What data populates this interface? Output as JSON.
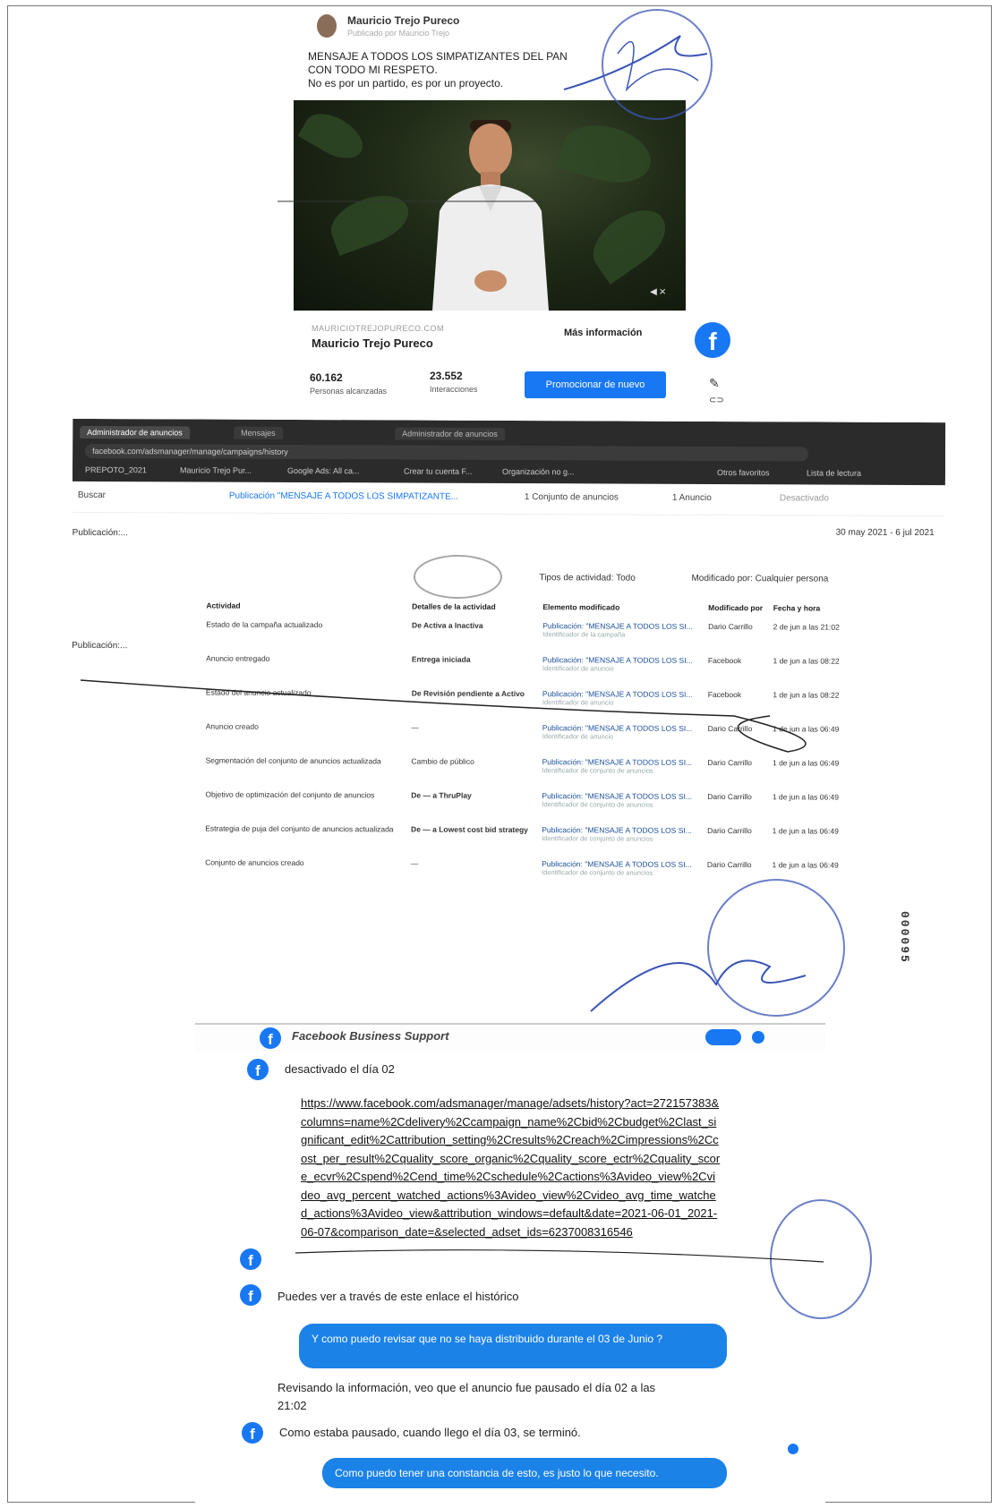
{
  "post": {
    "author": "Mauricio Trejo Pureco",
    "subtitle": "Publicado por Mauricio Trejo",
    "message_line1": "MENSAJE A TODOS LOS SIMPATIZANTES DEL PAN",
    "message_line2": "CON TODO MI RESPETO.",
    "message_line3": "No es por un partido, es por un proyecto.",
    "link_caption": "MAURICIOTREJOPURECO.COM",
    "link_title": "Mauricio Trejo Pureco",
    "cta": "Más información",
    "reach_value": "60.162",
    "reach_label": "Personas alcanzadas",
    "interactions_value": "23.552",
    "interactions_label": "Interacciones",
    "promote_button": "Promocionar de nuevo"
  },
  "ads_manager": {
    "tabs": [
      "Administrador de anuncios",
      "Mensajes",
      "Administrador de anuncios"
    ],
    "url": "facebook.com/adsmanager/manage/campaigns/history",
    "bookmarks": [
      "PREPOTO_2021",
      "Mauricio Trejo Pur...",
      "Google Ads: All ca...",
      "Crear tu cuenta F...",
      "Organización no g...",
      "Otros favoritos",
      "Lista de lectura"
    ],
    "search": "Buscar",
    "breadcrumb_publication": "Publicación \"MENSAJE A TODOS LOS SIMPATIZANTE...",
    "breadcrumb_adsets": "1 Conjunto de anuncios",
    "breadcrumb_ads": "1 Anuncio",
    "status": "Desactivado",
    "date_range": "30 may 2021 - 6 jul 2021",
    "side_item": "Publicación:...",
    "filter_activity": "Tipos de actividad: Todo",
    "filter_modified": "Modificado por: Cualquier persona",
    "headers": [
      "Actividad",
      "Detalles de la actividad",
      "Elemento modificado",
      "Modificado por",
      "Fecha y hora"
    ],
    "rows": [
      {
        "activity": "Estado de la campaña actualizado",
        "details": "De Activa a Inactiva",
        "element": "Publicación: \"MENSAJE A TODOS LOS SI...",
        "element_sub": "Identificador de la campaña",
        "by": "Dario Carrillo",
        "when": "2 de jun a las 21:02"
      },
      {
        "activity": "Anuncio entregado",
        "details": "Entrega iniciada",
        "element": "Publicación: \"MENSAJE A TODOS LOS SI...",
        "element_sub": "Identificador de anuncio",
        "by": "Facebook",
        "when": "1 de jun a las 08:22"
      },
      {
        "activity": "Estado del anuncio actualizado",
        "details": "De Revisión pendiente a Activo",
        "element": "Publicación: \"MENSAJE A TODOS LOS SI...",
        "element_sub": "Identificador de anuncio",
        "by": "Facebook",
        "when": "1 de jun a las 08:22"
      },
      {
        "activity": "Anuncio creado",
        "details": "—",
        "element": "Publicación: \"MENSAJE A TODOS LOS SI...",
        "element_sub": "Identificador de anuncio",
        "by": "Dario Carrillo",
        "when": "1 de jun a las 06:49"
      },
      {
        "activity": "Segmentación del conjunto de anuncios actualizada",
        "details": "Cambio de público",
        "element": "Publicación: \"MENSAJE A TODOS LOS SI...",
        "element_sub": "Identificador de conjunto de anuncios",
        "by": "Dario Carrillo",
        "when": "1 de jun a las 06:49"
      },
      {
        "activity": "Objetivo de optimización del conjunto de anuncios",
        "details": "De — a ThruPlay",
        "element": "Publicación: \"MENSAJE A TODOS LOS SI...",
        "element_sub": "Identificador de conjunto de anuncios",
        "by": "Dario Carrillo",
        "when": "1 de jun a las 06:49"
      },
      {
        "activity": "Estrategia de puja del conjunto de anuncios actualizada",
        "details": "De — a Lowest cost bid strategy",
        "element": "Publicación: \"MENSAJE A TODOS LOS SI...",
        "element_sub": "Identificador de conjunto de anuncios",
        "by": "Dario Carrillo",
        "when": "1 de jun a las 06:49"
      },
      {
        "activity": "Conjunto de anuncios creado",
        "details": "—",
        "element": "Publicación: \"MENSAJE A TODOS LOS SI...",
        "element_sub": "Identificador de conjunto de anuncios",
        "by": "Dario Carrillo",
        "when": "1 de jun a las 06:49"
      }
    ]
  },
  "serial": "000095",
  "chat": {
    "title": "Facebook Business Support",
    "msg1": "desactivado el día 02",
    "link_url": "https://www.facebook.com/adsmanager/manage/adsets/history?act=272157383&columns=name%2Cdelivery%2Ccampaign_name%2Cbid%2Cbudget%2Clast_significant_edit%2Cattribution_setting%2Cresults%2Creach%2Cimpressions%2Ccost_per_result%2Cquality_score_organic%2Cquality_score_ectr%2Cquality_score_ecvr%2Cspend%2Cend_time%2Cschedule%2Cactions%3Avideo_view%2Cvideo_avg_percent_watched_actions%3Avideo_view%2Cvideo_avg_time_watched_actions%3Avideo_view&attribution_windows=default&date=2021-06-01_2021-06-07&comparison_date=&selected_adset_ids=6237008316546",
    "msg2": "Puedes ver a través de este enlace el histórico",
    "user_msg1": "Y como puedo revisar que no se haya distribuido durante el 03 de Junio ?",
    "msg3": "Revisando la información, veo que el anuncio fue pausado el día 02 a las 21:02",
    "msg4": "Como estaba pausado, cuando llego el día 03, se terminó.",
    "user_msg2": "Como puedo tener una constancia de esto, es justo lo que necesito."
  },
  "colors": {
    "fb_blue": "#1877f2",
    "bubble_blue": "#1b82e8",
    "seal_blue": "#3a55b5"
  },
  "icons": [
    "facebook-logo-icon",
    "edit-icon",
    "link-icon",
    "mute-icon",
    "calendar-dropdown-icon"
  ]
}
